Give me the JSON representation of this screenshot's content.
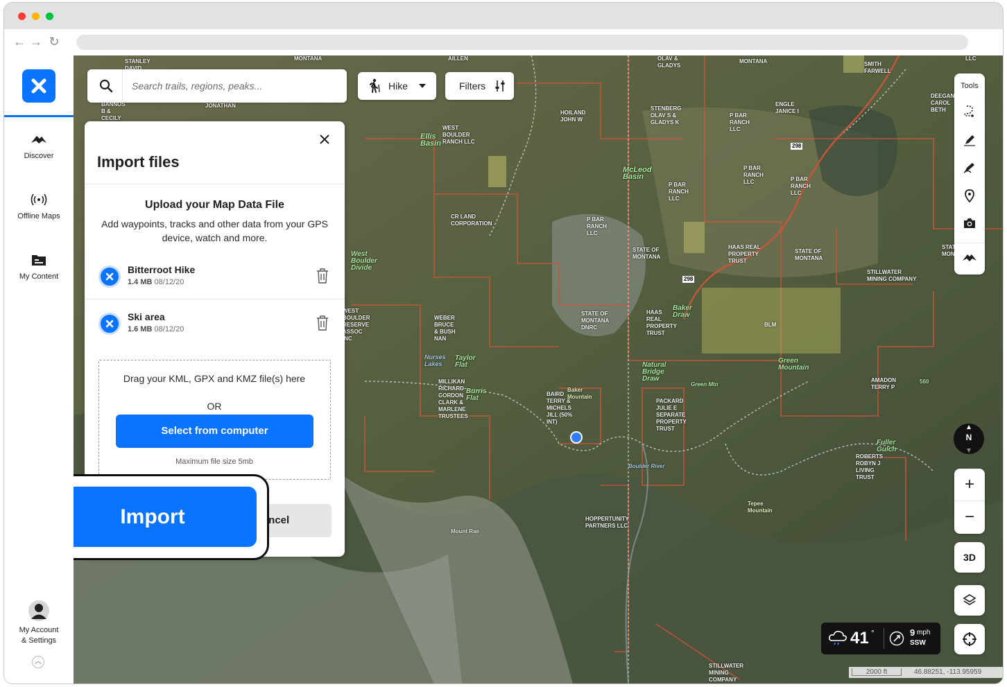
{
  "sidebar": {
    "items": [
      {
        "label": "Discover"
      },
      {
        "label": "Offline Maps"
      },
      {
        "label": "My Content"
      }
    ],
    "account_label_line1": "My Account",
    "account_label_line2": "& Settings"
  },
  "search": {
    "placeholder": "Search trails, regions, peaks..."
  },
  "activity": {
    "label": "Hike"
  },
  "filters": {
    "label": "Filters"
  },
  "tools": {
    "label": "Tools"
  },
  "map": {
    "labels": [
      "STANLEY DAVID",
      "MONTANA",
      "AILLEN",
      "OLAV & GLADYS",
      "MONTANA",
      "SMITH FARWELL",
      "LLC",
      "BANNOS B & CECILY",
      "JONATHAN",
      "HOILAND JOHN W",
      "STENBERG OLAV S & GLADYS K",
      "P BAR RANCH LLC",
      "ENGLE JANICE I",
      "DEEGAN CAROL BETH",
      "Ellis Basin",
      "WEST BOULDER RANCH LLC",
      "McLeod Basin",
      "P BAR RANCH LLC",
      "P BAR RANCH LLC",
      "P BAR RANCH LLC",
      "CR LAND CORPORATION",
      "P BAR RANCH LLC",
      "STATE OF MONTANA",
      "HAAS REAL PROPERTY TRUST",
      "STATE OF MONTANA",
      "STATE OF MONTA",
      "STILLWATER MINING COMPANY",
      "West Boulder Divide",
      "WEST BOULDER RESERVE ASSOC INC",
      "WEBER BRUCE & BUSH NAN",
      "STATE OF MONTANA DNRC",
      "HAAS REAL PROPERTY TRUST",
      "Baker Draw",
      "BLM",
      "Green Mountain",
      "Nurses Lakes",
      "Taylor Flat",
      "MILLIKAN RICHARD GORDON CLARK & MARLENE TRUSTEES",
      "Burris Flat",
      "BAIRD TERRY & MICHELS JILL (50% INT)",
      "Baker Mountain",
      "Natural Bridge Draw",
      "PACKARD JULIE E SEPARATE PROPERTY TRUST",
      "AMADON TERRY P",
      "Mount Rae",
      "HOPPERTUNITY PARTNERS LLC",
      "Tepee Mountain",
      "ROBERTS ROBYN J LIVING TRUST",
      "Fuller Gulch",
      "STILLWATER MINING COMPANY",
      "298",
      "298",
      "560",
      "Green Mtn",
      "Boulder River"
    ]
  },
  "import_panel": {
    "title": "Import files",
    "upload_title": "Upload your Map Data File",
    "upload_desc": "Add waypoints, tracks and other data from your GPS device, watch and more.",
    "files": [
      {
        "name": "Bitterroot Hike",
        "size": "1.4 MB",
        "date": "08/12/20"
      },
      {
        "name": "Ski area",
        "size": "1.6 MB",
        "date": "08/12/20"
      }
    ],
    "drop_text": "Drag your KML, GPX and KMZ file(s) here",
    "or_text": "OR",
    "select_button": "Select from computer",
    "max_size": "Maximum file size 5mb",
    "cancel_button": "Cancel",
    "import_button": "Import"
  },
  "compass": {
    "label": "N"
  },
  "zoom": {
    "in": "+",
    "out": "−"
  },
  "mode_3d": {
    "label": "3D"
  },
  "weather": {
    "temp": "41",
    "degree": "°",
    "wind_speed": "9",
    "wind_unit": "mph",
    "wind_dir": "SSW"
  },
  "scale": {
    "label": "2000 ft"
  },
  "coords": {
    "label": "46.88251, -113.95959"
  },
  "colors": {
    "accent": "#0a73ff",
    "parcel": "#c8553a",
    "dark": "#121212"
  }
}
